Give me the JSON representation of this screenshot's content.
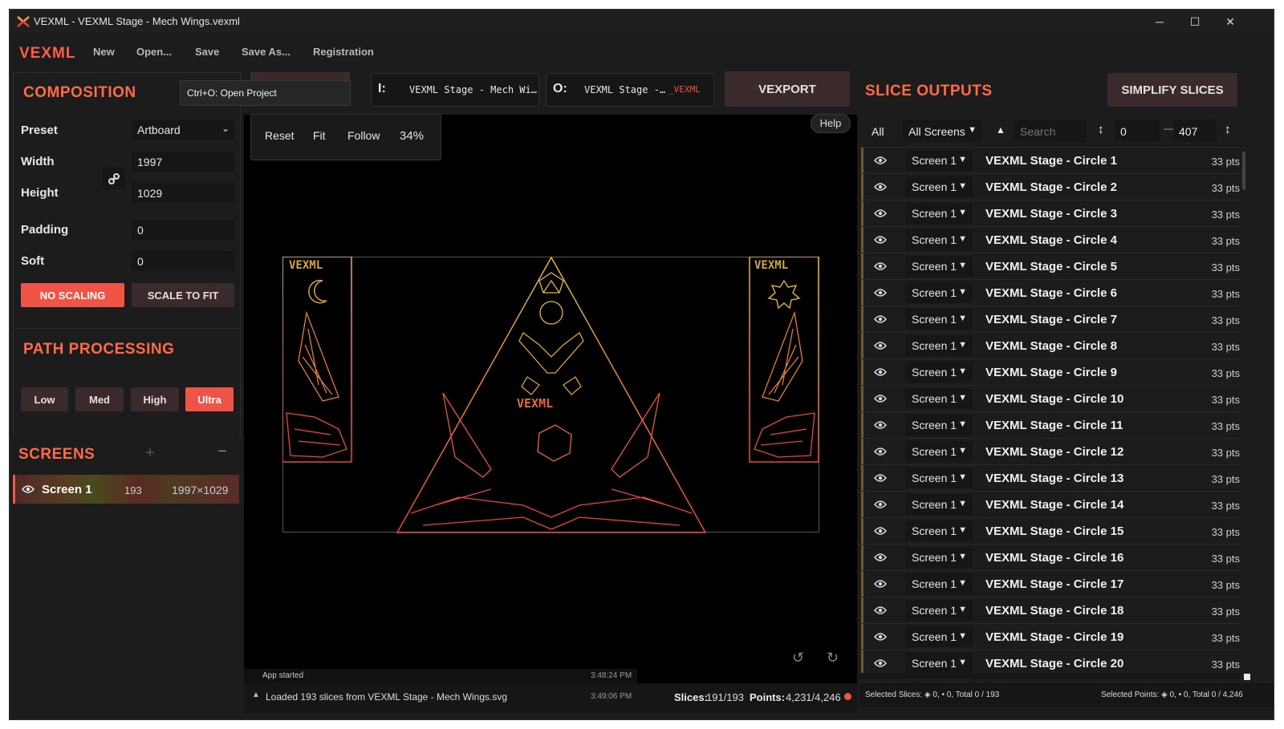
{
  "titlebar": {
    "title": "VEXML - VEXML Stage - Mech Wings.vexml"
  },
  "menubar": {
    "logo": "VEXML",
    "items": [
      "New",
      "Open...",
      "Save",
      "Save As...",
      "Registration"
    ]
  },
  "tooltip": "Ctrl+O: Open Project",
  "composition": {
    "title": "COMPOSITION",
    "preset_label": "Preset",
    "preset_value": "Artboard",
    "width_label": "Width",
    "width_value": "1997",
    "height_label": "Height",
    "height_value": "1029",
    "padding_label": "Padding",
    "padding_value": "0",
    "soft_label": "Soft",
    "soft_value": "0",
    "no_scaling": "NO SCALING",
    "scale_to_fit": "SCALE TO FIT"
  },
  "path_processing": {
    "title": "PATH PROCESSING",
    "levels": [
      "Low",
      "Med",
      "High",
      "Ultra"
    ],
    "active": "Ultra"
  },
  "screens": {
    "title": "SCREENS",
    "item": {
      "name": "Screen 1",
      "count": "193",
      "size": "1997×1029"
    }
  },
  "io": {
    "input_prefix": "I:",
    "input_value": "VEXML Stage - Mech Wi…",
    "output_prefix": "O:",
    "output_value": "VEXML Stage -…",
    "output_suffix": "_VEXML"
  },
  "vexport_label": "VEXPORT",
  "viewport": {
    "reset": "Reset",
    "fit": "Fit",
    "follow": "Follow",
    "zoom": "34%",
    "help": "Help",
    "artboard_logo": "VEXML"
  },
  "log": {
    "entries": [
      {
        "text": "App started",
        "time": "3:48:24 PM"
      },
      {
        "text": "Loaded 193 slices from VEXML Stage - Mech Wings.svg",
        "time": "3:49:06 PM"
      }
    ],
    "slices_label": "Slices:",
    "slices_value": "191/193",
    "points_label": "Points:",
    "points_value": "4,231/4,246"
  },
  "slice_outputs": {
    "title": "SLICE OUTPUTS",
    "simplify": "SIMPLIFY SLICES",
    "filter_all": "All",
    "filter_screens": "All Screens",
    "search_placeholder": "Search",
    "range_from": "0",
    "range_to": "407",
    "rows": [
      {
        "screen": "Screen 1",
        "name": "VEXML Stage - Circle 1",
        "pts": "33 pts"
      },
      {
        "screen": "Screen 1",
        "name": "VEXML Stage - Circle 2",
        "pts": "33 pts"
      },
      {
        "screen": "Screen 1",
        "name": "VEXML Stage - Circle 3",
        "pts": "33 pts"
      },
      {
        "screen": "Screen 1",
        "name": "VEXML Stage - Circle 4",
        "pts": "33 pts"
      },
      {
        "screen": "Screen 1",
        "name": "VEXML Stage - Circle 5",
        "pts": "33 pts"
      },
      {
        "screen": "Screen 1",
        "name": "VEXML Stage - Circle 6",
        "pts": "33 pts"
      },
      {
        "screen": "Screen 1",
        "name": "VEXML Stage - Circle 7",
        "pts": "33 pts"
      },
      {
        "screen": "Screen 1",
        "name": "VEXML Stage - Circle 8",
        "pts": "33 pts"
      },
      {
        "screen": "Screen 1",
        "name": "VEXML Stage - Circle 9",
        "pts": "33 pts"
      },
      {
        "screen": "Screen 1",
        "name": "VEXML Stage - Circle 10",
        "pts": "33 pts"
      },
      {
        "screen": "Screen 1",
        "name": "VEXML Stage - Circle 11",
        "pts": "33 pts"
      },
      {
        "screen": "Screen 1",
        "name": "VEXML Stage - Circle 12",
        "pts": "33 pts"
      },
      {
        "screen": "Screen 1",
        "name": "VEXML Stage - Circle 13",
        "pts": "33 pts"
      },
      {
        "screen": "Screen 1",
        "name": "VEXML Stage - Circle 14",
        "pts": "33 pts"
      },
      {
        "screen": "Screen 1",
        "name": "VEXML Stage - Circle 15",
        "pts": "33 pts"
      },
      {
        "screen": "Screen 1",
        "name": "VEXML Stage - Circle 16",
        "pts": "33 pts"
      },
      {
        "screen": "Screen 1",
        "name": "VEXML Stage - Circle 17",
        "pts": "33 pts"
      },
      {
        "screen": "Screen 1",
        "name": "VEXML Stage - Circle 18",
        "pts": "33 pts"
      },
      {
        "screen": "Screen 1",
        "name": "VEXML Stage - Circle 19",
        "pts": "33 pts"
      },
      {
        "screen": "Screen 1",
        "name": "VEXML Stage - Circle 20",
        "pts": "33 pts"
      }
    ],
    "selected_slices": "Selected Slices: ◈ 0, • 0, Total 0 / 193",
    "selected_points": "Selected Points: ◈ 0, • 0, Total 0 / 4,246"
  },
  "colors": {
    "accent": "#ff5d47",
    "primary_button": "#ef5446",
    "dark_button": "#3a2a2c",
    "artwork_red": "#e8453a",
    "artwork_yellow": "#e3b83a"
  },
  "icons": [
    "app-logo-icon",
    "minimize-icon",
    "maximize-icon",
    "close-icon",
    "link-icon",
    "plus-icon",
    "minus-icon",
    "eye-icon",
    "chevron-down-icon",
    "sort-icon",
    "undo-icon",
    "redo-icon",
    "warning-icon"
  ]
}
